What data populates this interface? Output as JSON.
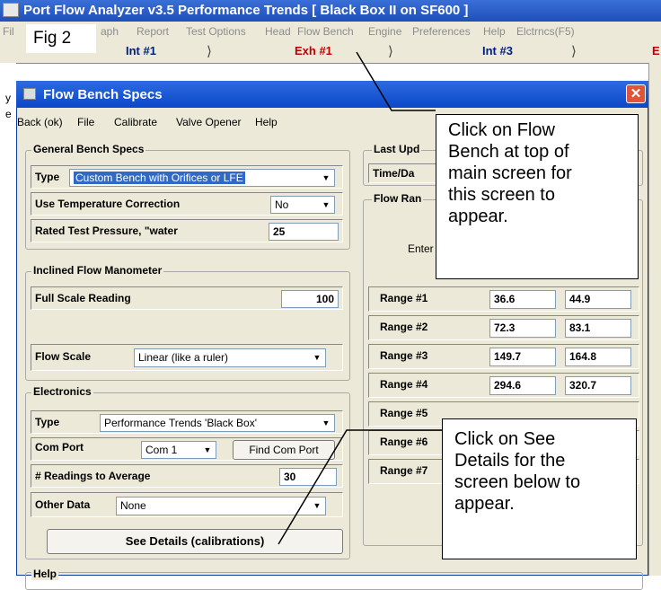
{
  "main_window": {
    "title": "Port Flow Analyzer v3.5   Performance Trends   [ Black Box II on SF600 ]",
    "menu": [
      "Fil",
      "aph",
      "Report",
      "Test Options",
      "Head",
      "Flow Bench",
      "Engine",
      "Preferences",
      "Help",
      "Elctrncs(F5)"
    ],
    "tabs": [
      "Int #1",
      "Exh #1",
      "Int #3",
      "E"
    ],
    "left_fragments": [
      "y",
      "e"
    ]
  },
  "figure_label": "Fig 2",
  "dialog": {
    "title": "Flow Bench Specs",
    "close_glyph": "✕",
    "menu": [
      "Back (ok)",
      "File",
      "Calibrate",
      "Valve Opener",
      "Help"
    ],
    "general": {
      "title": "General Bench Specs",
      "type_label": "Type",
      "type_value": "Custom Bench with Orifices or LFE",
      "temp_label": "Use Temperature Correction",
      "temp_value": "No",
      "pressure_label": "Rated Test Pressure, \"water",
      "pressure_value": "25"
    },
    "manometer": {
      "title": "Inclined Flow Manometer",
      "full_scale_label": "Full Scale Reading",
      "full_scale_value": "100",
      "flow_scale_label": "Flow Scale",
      "flow_scale_value": "Linear (like a ruler)"
    },
    "electronics": {
      "title": "Electronics",
      "type_label": "Type",
      "type_value": "Performance Trends 'Black Box'",
      "com_label": "Com Port",
      "com_value": "Com 1",
      "find_button": "Find Com Port",
      "readings_label": "# Readings to Average",
      "readings_value": "30",
      "other_label": "Other Data",
      "other_value": "None",
      "details_button": "See Details (calibrations)"
    },
    "bottom_group_title": "Help",
    "last_update": {
      "title": "Last Upd",
      "time_label": "Time/Da"
    },
    "flow_ranges": {
      "title": "Flow Ran",
      "enter_text": "Enter",
      "rows": [
        {
          "label": "Range #1",
          "v1": "36.6",
          "v2": "44.9"
        },
        {
          "label": "Range #2",
          "v1": "72.3",
          "v2": "83.1"
        },
        {
          "label": "Range #3",
          "v1": "149.7",
          "v2": "164.8"
        },
        {
          "label": "Range #4",
          "v1": "294.6",
          "v2": "320.7"
        },
        {
          "label": "Range #5"
        },
        {
          "label": "Range #6"
        },
        {
          "label": "Range #7"
        }
      ]
    }
  },
  "callouts": {
    "top": [
      "Click on Flow",
      "Bench at top of",
      "main screen for",
      "this screen to",
      "appear."
    ],
    "bottom": [
      "Click on See",
      "Details for the",
      "screen below to",
      "appear."
    ]
  },
  "colors": {
    "titlebar_blue": "#1f4fb8",
    "dialog_face": "#ece9d8",
    "close_red": "#e0553a",
    "tab_red": "#c00000",
    "tab_blue": "#00207a",
    "selection_blue": "#316ac5"
  },
  "icons": [
    "app-icon",
    "dialog-icon",
    "close-icon",
    "dropdown-arrow-icon"
  ]
}
